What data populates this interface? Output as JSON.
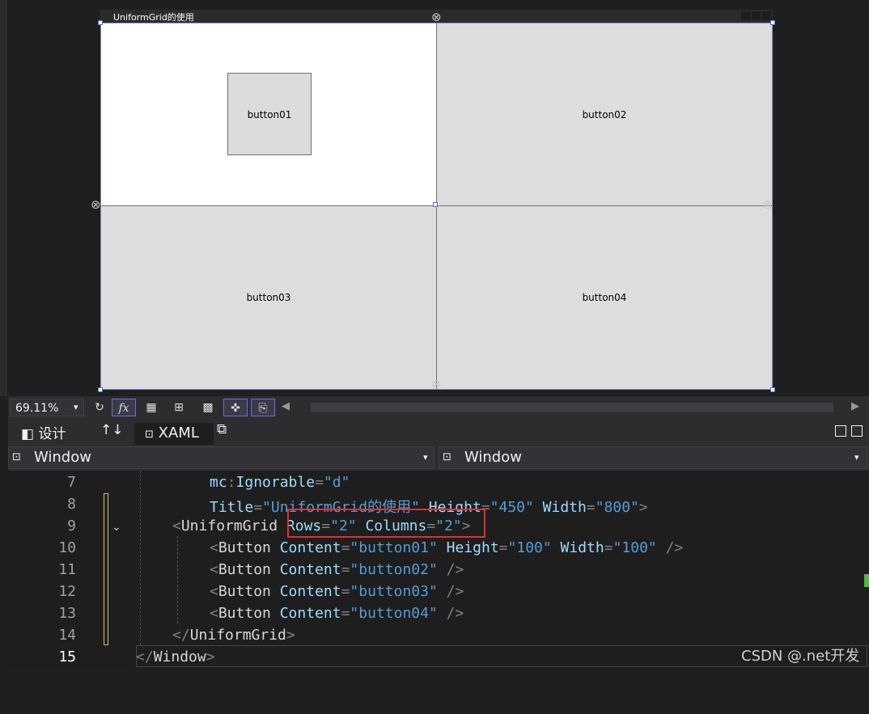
{
  "designer": {
    "window_title": "UniformGrid的使用",
    "buttons": [
      "button01",
      "button02",
      "button03",
      "button04"
    ]
  },
  "toolbar": {
    "zoom": "69.11%",
    "zoom_caret": "▾",
    "refresh_icon": "↻",
    "fx_label": "fx",
    "grid_icon": "▦",
    "scroll_left": "◀",
    "scroll_right": "▶"
  },
  "tabs": {
    "design_icon": "◧",
    "design_label": "设计",
    "swap_icon": "↑↓",
    "xaml_icon": "⊡",
    "xaml_label": "XAML",
    "popout_icon": "⧉"
  },
  "selectors": {
    "left": "Window",
    "right": "Window",
    "icon": "⊡",
    "caret": "▾"
  },
  "editor": {
    "fold_icon": "⌄",
    "lines": [
      {
        "num": "7"
      },
      {
        "num": "8"
      },
      {
        "num": "9"
      },
      {
        "num": "10"
      },
      {
        "num": "11"
      },
      {
        "num": "12"
      },
      {
        "num": "13"
      },
      {
        "num": "14"
      },
      {
        "num": "15"
      }
    ],
    "tokens": {
      "l7_ns": "mc",
      "l7_colon": ":",
      "l7_attr": "Ignorable",
      "l7_eq": "=",
      "l7_val": "\"d\"",
      "l8_attr1": "Title",
      "l8_eq1": "=",
      "l8_val1": "\"UniformGrid的使用\"",
      "l8_attr2": "Height",
      "l8_eq2": "=",
      "l8_val2": "\"450\"",
      "l8_attr3": "Width",
      "l8_eq3": "=",
      "l8_val3": "\"800\"",
      "l8_close": ">",
      "l9_open": "<",
      "l9_el": "UniformGrid",
      "l9_attr1": "Rows",
      "l9_eq1": "=",
      "l9_val1": "\"2\"",
      "l9_attr2": "Columns",
      "l9_eq2": "=",
      "l9_val2": "\"2\"",
      "l9_close": ">",
      "btn_open": "<",
      "btn_el": "Button",
      "btn_attr": "Content",
      "btn_eq": "=",
      "btn_close": "/>",
      "l10_val": "\"button01\"",
      "l10_attr2": "Height",
      "l10_val2": "\"100\"",
      "l10_attr3": "Width",
      "l10_val3": "\"100\"",
      "l11_val": "\"button02\"",
      "l12_val": "\"button03\"",
      "l13_val": "\"button04\"",
      "l14_open": "</",
      "l14_el": "UniformGrid",
      "l14_close": ">",
      "l15_open": "</",
      "l15_el": "Window",
      "l15_close": ">"
    }
  },
  "watermark": "CSDN @.net开发"
}
